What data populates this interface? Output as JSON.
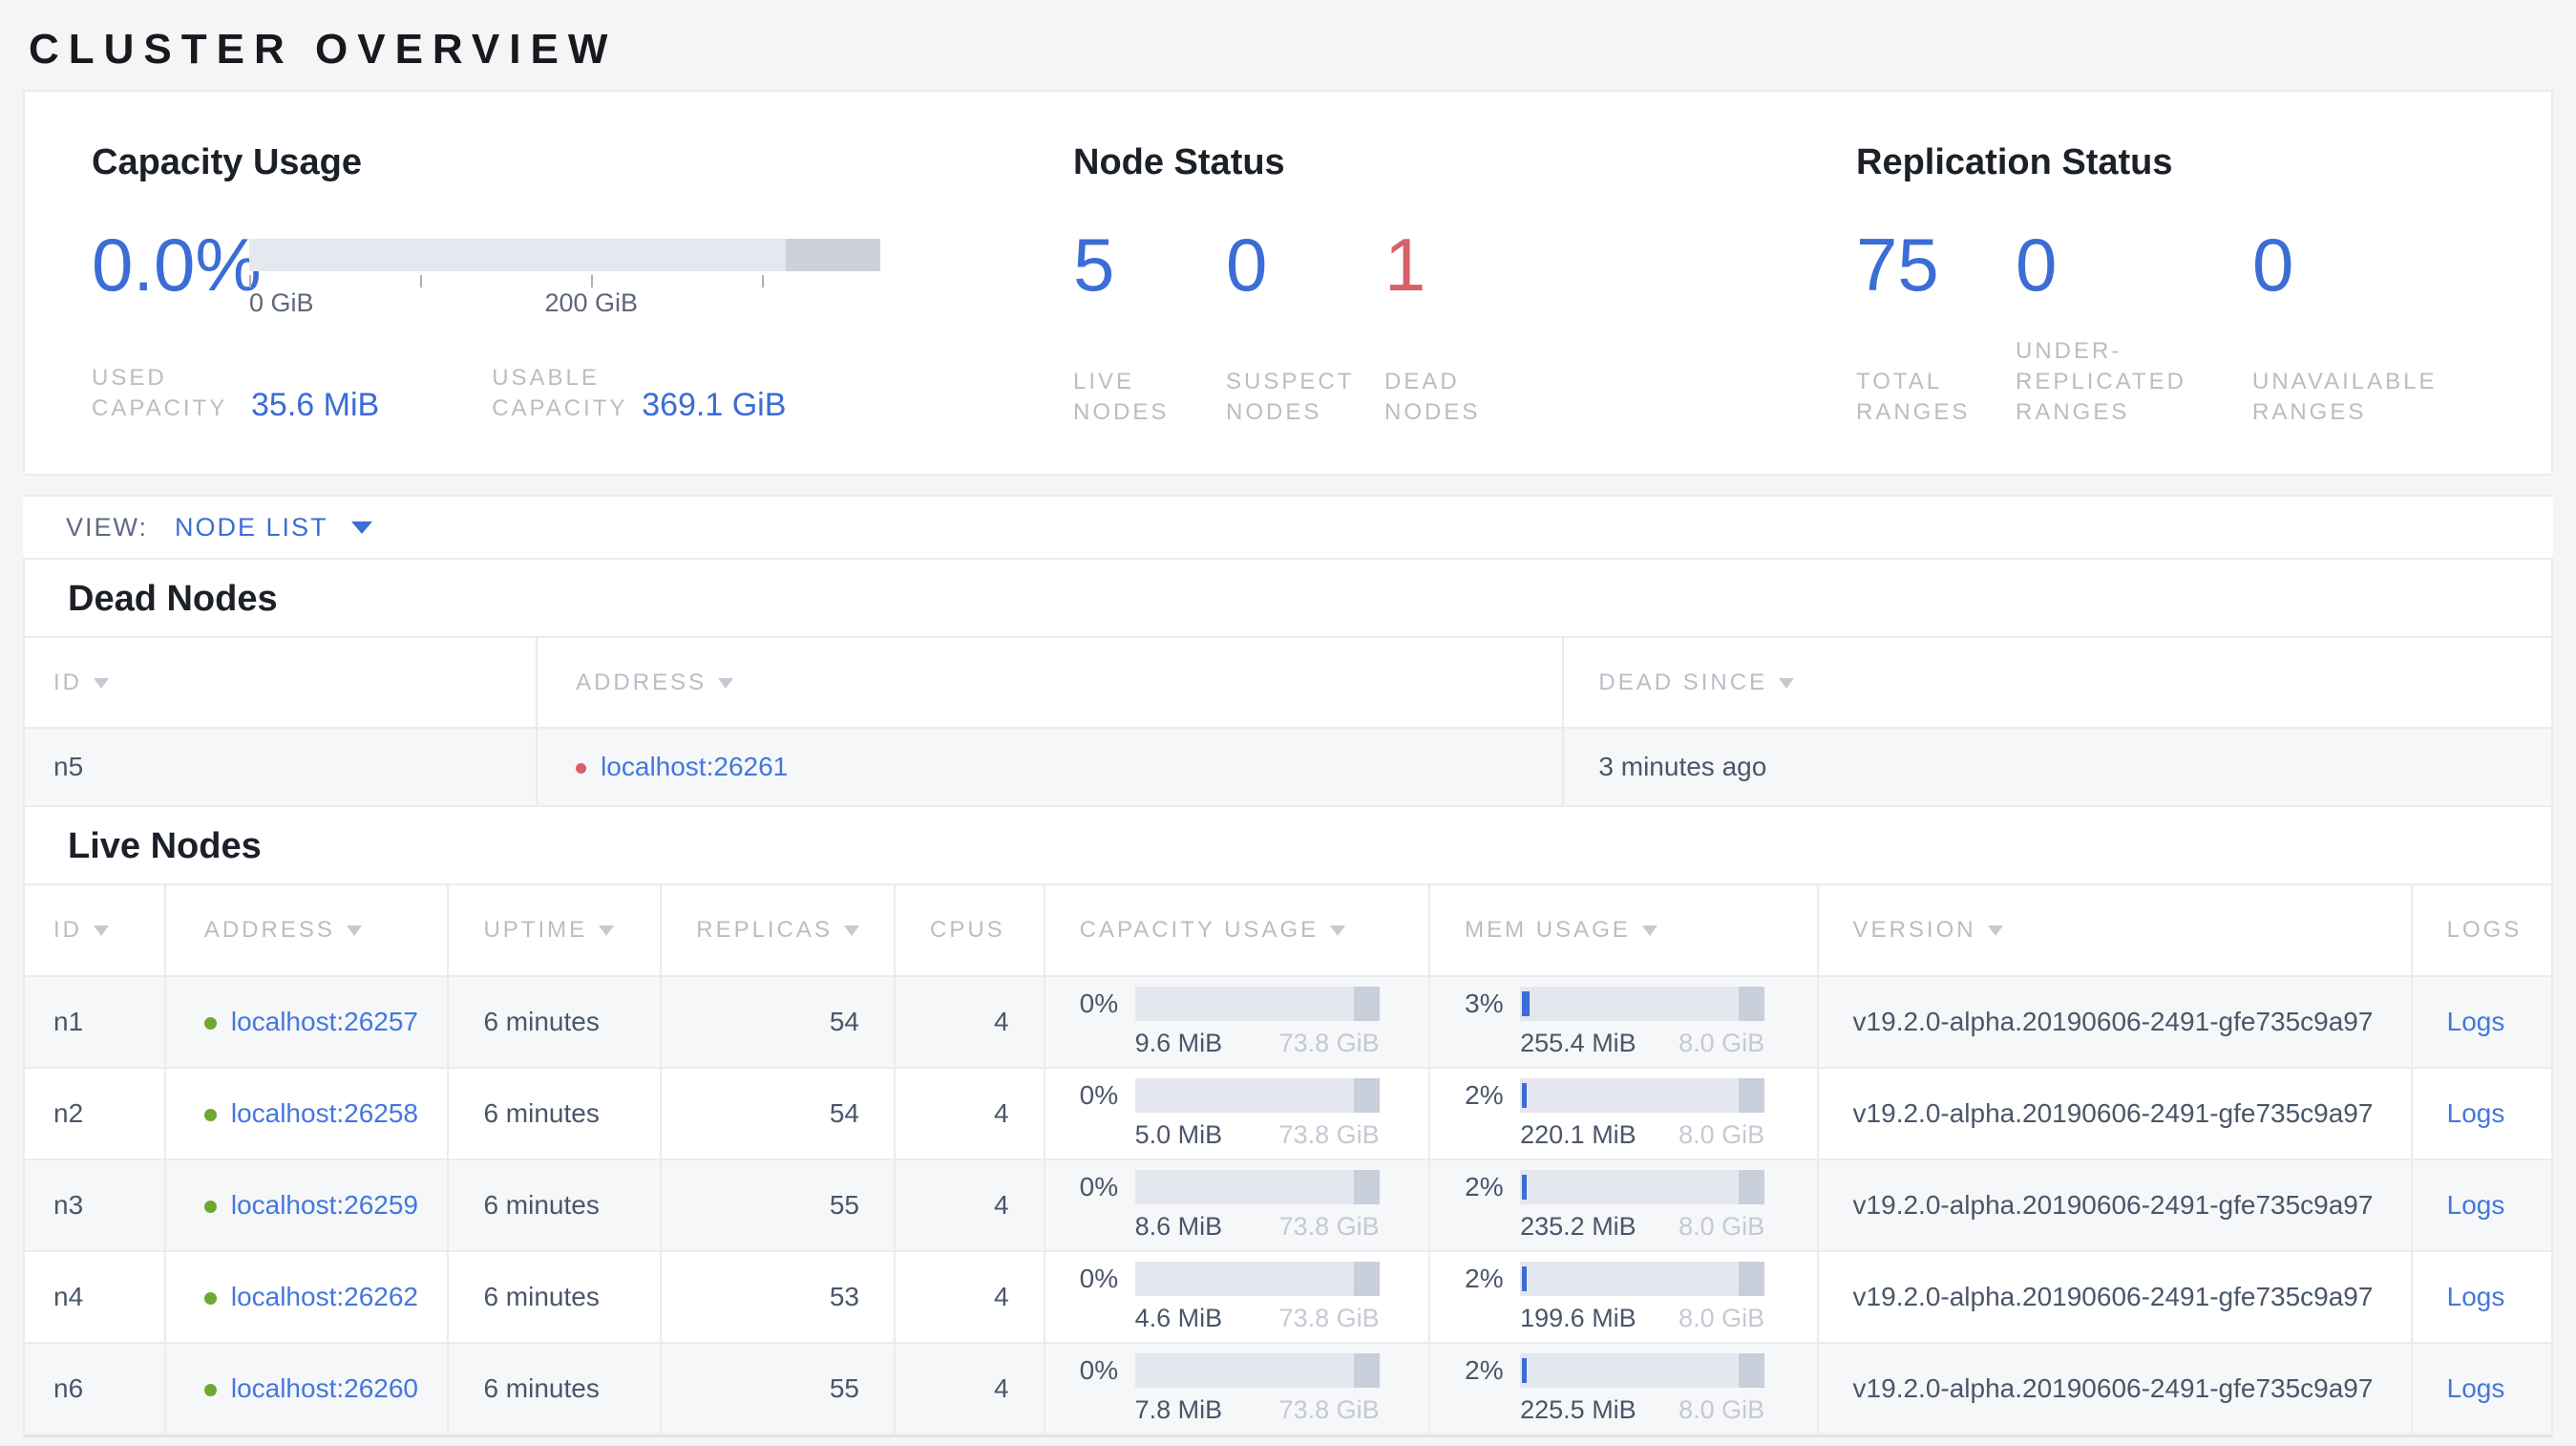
{
  "page": {
    "title": "CLUSTER OVERVIEW"
  },
  "colors": {
    "accent_blue": "#3c6dd5",
    "status_red": "#d8606a",
    "live_green": "#6fa831"
  },
  "summary": {
    "capacity": {
      "title": "Capacity Usage",
      "percent": "0.0%",
      "bar": {
        "other_start_pct": 85,
        "other_end_pct": 100
      },
      "ticks": [
        {
          "pos": 0,
          "label": "0 GiB"
        },
        {
          "pos": 27.1,
          "label": ""
        },
        {
          "pos": 54.2,
          "label": "200 GiB"
        },
        {
          "pos": 81.3,
          "label": ""
        }
      ],
      "stats": [
        {
          "label": "USED\nCAPACITY",
          "value": "35.6 MiB"
        },
        {
          "label": "USABLE\nCAPACITY",
          "value": "369.1 GiB"
        }
      ]
    },
    "node_status": {
      "title": "Node Status",
      "items": [
        {
          "value": "5",
          "label": "LIVE\nNODES",
          "state": "blue"
        },
        {
          "value": "0",
          "label": "SUSPECT\nNODES",
          "state": "blue"
        },
        {
          "value": "1",
          "label": "DEAD\nNODES",
          "state": "red"
        }
      ]
    },
    "replication": {
      "title": "Replication Status",
      "items": [
        {
          "value": "75",
          "label": "TOTAL\nRANGES"
        },
        {
          "value": "0",
          "label": "UNDER-\nREPLICATED\nRANGES"
        },
        {
          "value": "0",
          "label": "UNAVAILABLE\nRANGES"
        }
      ]
    }
  },
  "view_bar": {
    "label": "VIEW:",
    "value": "NODE LIST"
  },
  "dead_nodes": {
    "heading": "Dead Nodes",
    "columns": [
      "ID",
      "ADDRESS",
      "DEAD SINCE"
    ],
    "rows": [
      {
        "id": "n5",
        "address": "localhost:26261",
        "dead_since": "3 minutes ago"
      }
    ]
  },
  "live_nodes": {
    "heading": "Live Nodes",
    "columns": [
      "ID",
      "ADDRESS",
      "UPTIME",
      "REPLICAS",
      "CPUS",
      "CAPACITY USAGE",
      "MEM USAGE",
      "VERSION",
      "LOGS"
    ],
    "rows": [
      {
        "id": "n1",
        "address": "localhost:26257",
        "uptime": "6 minutes",
        "replicas": "54",
        "cpus": "4",
        "cap_pct": "0%",
        "cap_used": "9.6 MiB",
        "cap_total": "73.8 GiB",
        "mem_pct": "3%",
        "mem_pct_num": 3,
        "mem_used": "255.4 MiB",
        "mem_total": "8.0 GiB",
        "version": "v19.2.0-alpha.20190606-2491-gfe735c9a97",
        "logs": "Logs"
      },
      {
        "id": "n2",
        "address": "localhost:26258",
        "uptime": "6 minutes",
        "replicas": "54",
        "cpus": "4",
        "cap_pct": "0%",
        "cap_used": "5.0 MiB",
        "cap_total": "73.8 GiB",
        "mem_pct": "2%",
        "mem_pct_num": 2,
        "mem_used": "220.1 MiB",
        "mem_total": "8.0 GiB",
        "version": "v19.2.0-alpha.20190606-2491-gfe735c9a97",
        "logs": "Logs"
      },
      {
        "id": "n3",
        "address": "localhost:26259",
        "uptime": "6 minutes",
        "replicas": "55",
        "cpus": "4",
        "cap_pct": "0%",
        "cap_used": "8.6 MiB",
        "cap_total": "73.8 GiB",
        "mem_pct": "2%",
        "mem_pct_num": 2,
        "mem_used": "235.2 MiB",
        "mem_total": "8.0 GiB",
        "version": "v19.2.0-alpha.20190606-2491-gfe735c9a97",
        "logs": "Logs"
      },
      {
        "id": "n4",
        "address": "localhost:26262",
        "uptime": "6 minutes",
        "replicas": "53",
        "cpus": "4",
        "cap_pct": "0%",
        "cap_used": "4.6 MiB",
        "cap_total": "73.8 GiB",
        "mem_pct": "2%",
        "mem_pct_num": 2,
        "mem_used": "199.6 MiB",
        "mem_total": "8.0 GiB",
        "version": "v19.2.0-alpha.20190606-2491-gfe735c9a97",
        "logs": "Logs"
      },
      {
        "id": "n6",
        "address": "localhost:26260",
        "uptime": "6 minutes",
        "replicas": "55",
        "cpus": "4",
        "cap_pct": "0%",
        "cap_used": "7.8 MiB",
        "cap_total": "73.8 GiB",
        "mem_pct": "2%",
        "mem_pct_num": 2,
        "mem_used": "225.5 MiB",
        "mem_total": "8.0 GiB",
        "version": "v19.2.0-alpha.20190606-2491-gfe735c9a97",
        "logs": "Logs"
      }
    ]
  }
}
